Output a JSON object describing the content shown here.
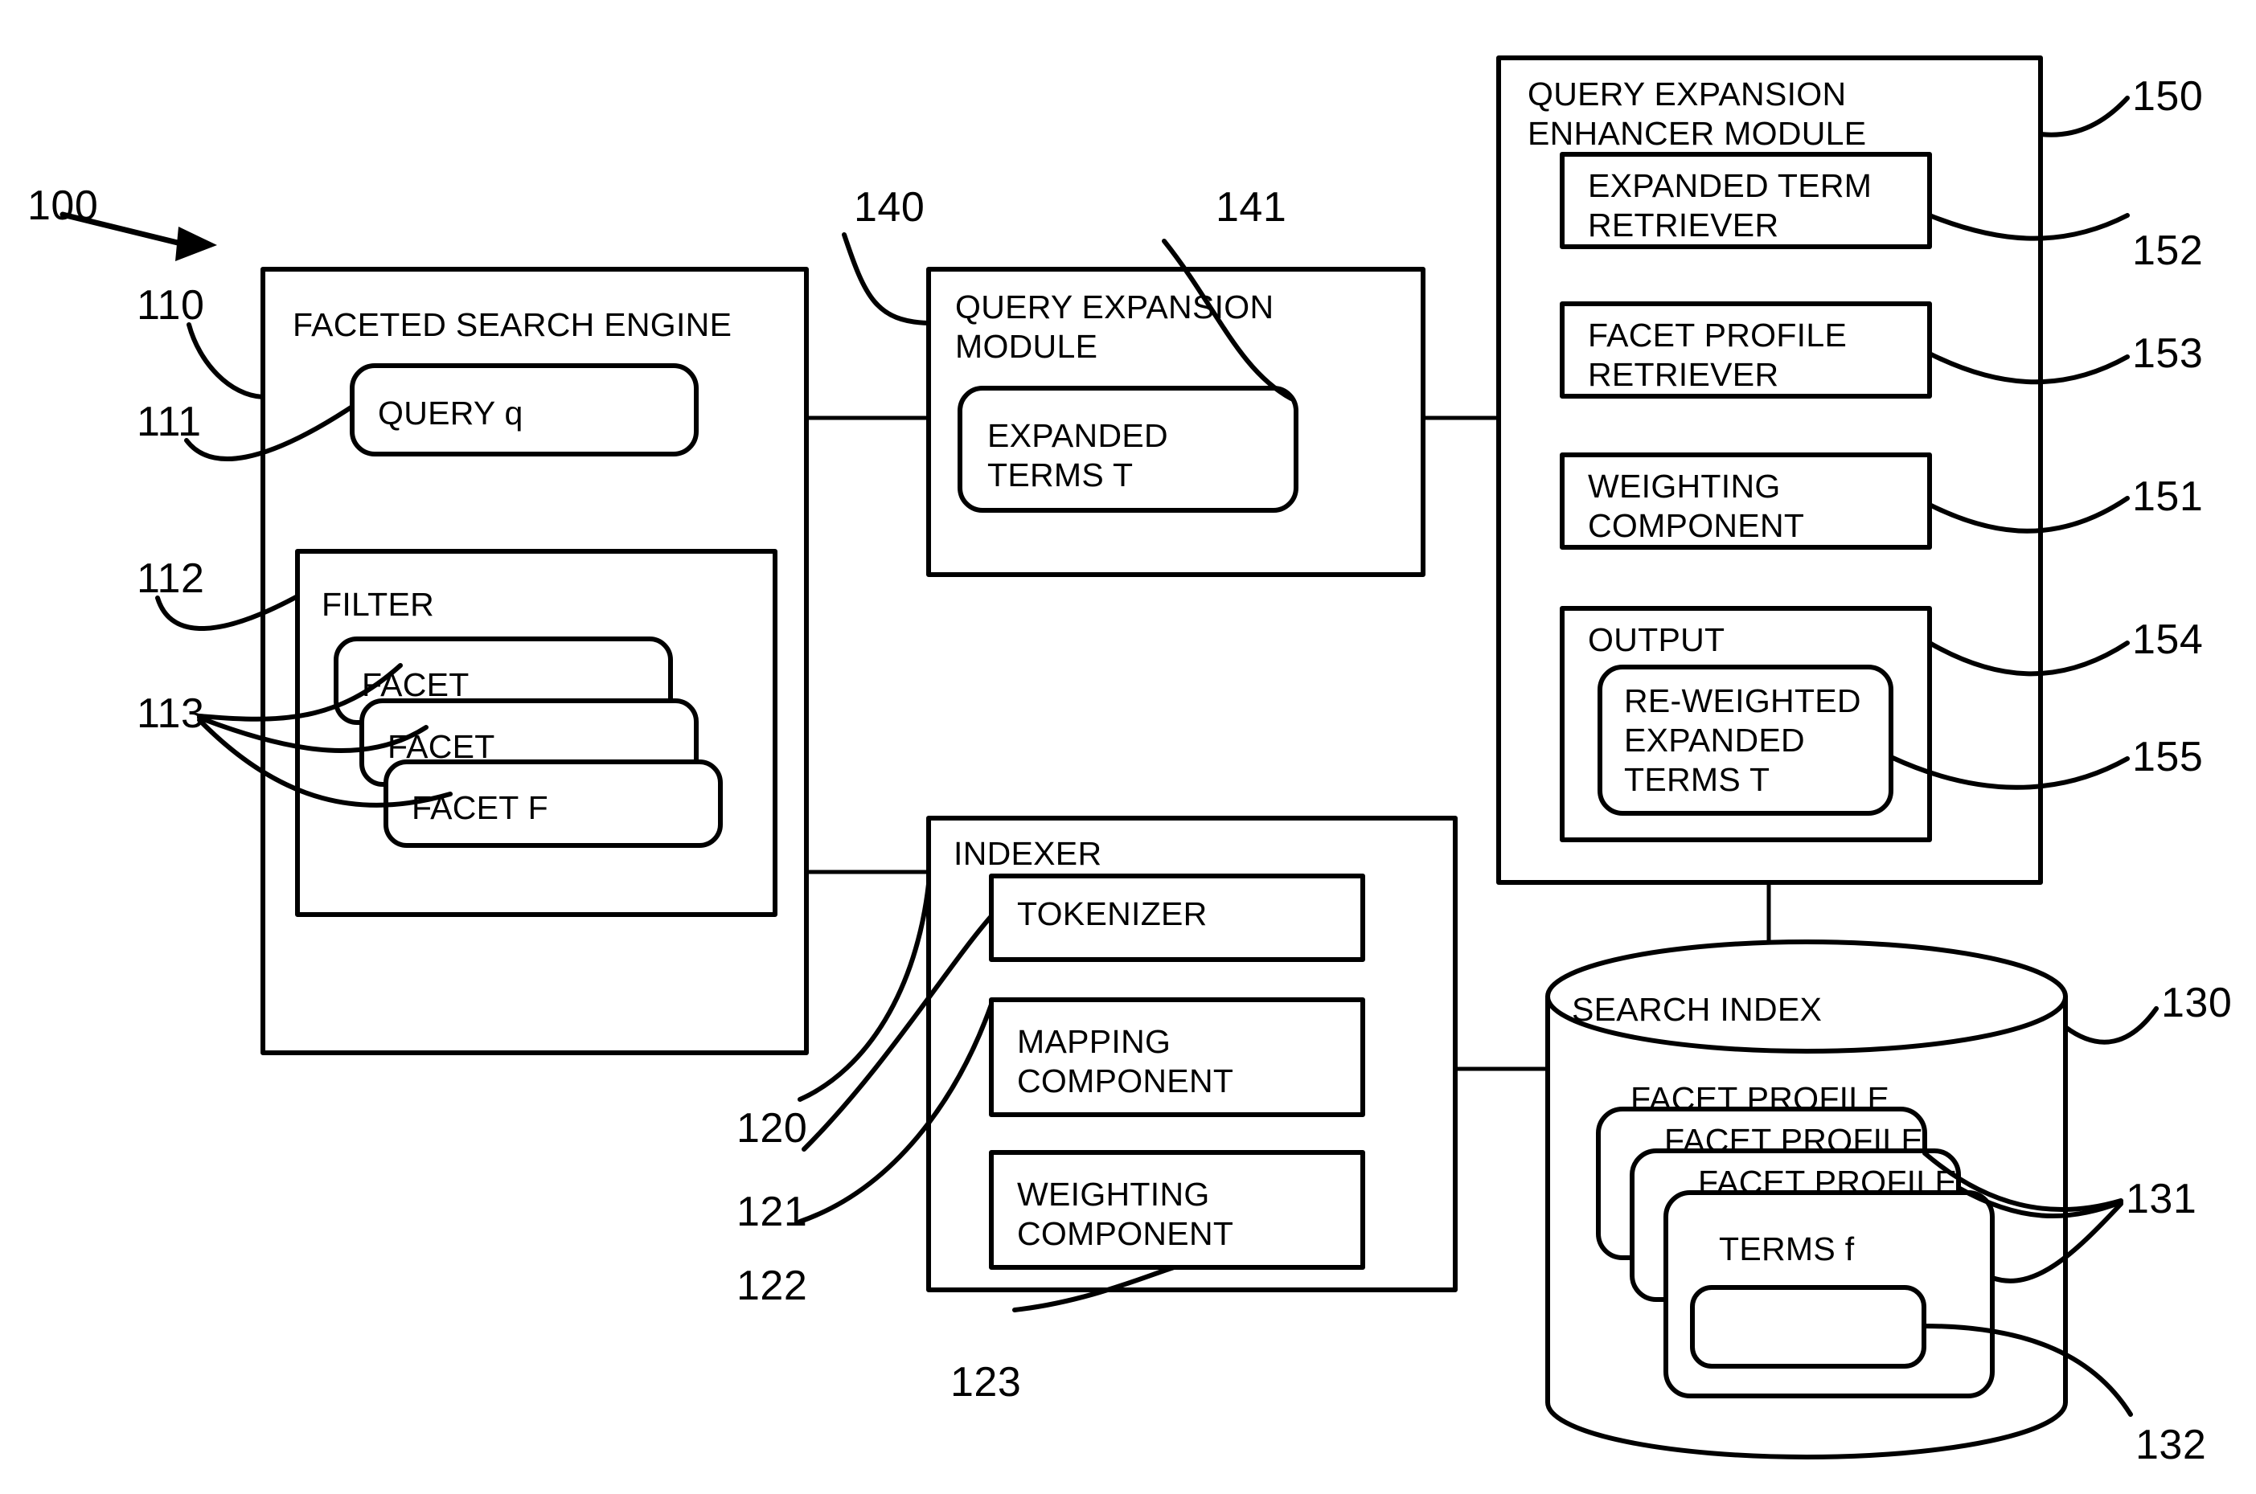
{
  "figure": {
    "type": "patent-block-diagram",
    "overall_ref": "100"
  },
  "blocks": {
    "faceted_search_engine": {
      "title": "FACETED SEARCH ENGINE",
      "ref": "110",
      "query": {
        "label": "QUERY q",
        "ref": "111"
      },
      "filter": {
        "label": "FILTER",
        "ref": "112",
        "facets_ref": "113",
        "facets": [
          "FACET",
          "FACET",
          "FACET F"
        ]
      }
    },
    "query_expansion_module": {
      "title_line1": "QUERY EXPANSION",
      "title_line2": "MODULE",
      "ref": "140",
      "expanded_terms": {
        "line1": "EXPANDED",
        "line2": "TERMS T",
        "ref": "141"
      }
    },
    "query_expansion_enhancer_module": {
      "title_line1": "QUERY EXPANSION",
      "title_line2": "ENHANCER MODULE",
      "ref": "150",
      "components": [
        {
          "line1": "EXPANDED TERM",
          "line2": "RETRIEVER",
          "ref": "152"
        },
        {
          "line1": "FACET PROFILE",
          "line2": "RETRIEVER",
          "ref": "153"
        },
        {
          "line1": "WEIGHTING",
          "line2": "COMPONENT",
          "ref": "151"
        }
      ],
      "output": {
        "label": "OUTPUT",
        "ref": "154",
        "inner": {
          "line1": "RE-WEIGHTED",
          "line2": "EXPANDED",
          "line3": "TERMS T",
          "ref": "155"
        }
      }
    },
    "indexer": {
      "title": "INDEXER",
      "ref": "120",
      "components": [
        {
          "line1": "TOKENIZER",
          "line2": "",
          "ref": "121"
        },
        {
          "line1": "MAPPING",
          "line2": "COMPONENT",
          "ref": "122"
        },
        {
          "line1": "WEIGHTING",
          "line2": "COMPONENT",
          "ref": "123"
        }
      ]
    },
    "search_index": {
      "title": "SEARCH INDEX",
      "ref": "130",
      "facet_profiles_ref": "131",
      "facet_profiles": [
        "FACET PROFILE",
        "FACET PROFILE",
        "FACET PROFILE"
      ],
      "terms": {
        "label": "TERMS f",
        "ref": "132"
      }
    }
  }
}
